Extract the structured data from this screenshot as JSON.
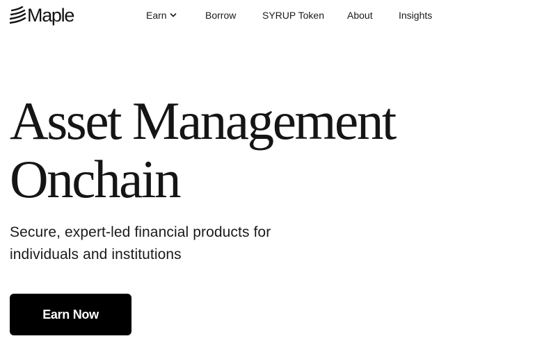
{
  "brand": {
    "name": "Maple",
    "logo_icon": "maple-wave-icon"
  },
  "nav": {
    "items": [
      {
        "label": "Earn",
        "has_dropdown": true,
        "icon": "chevron-down-icon"
      },
      {
        "label": "Borrow"
      },
      {
        "label": "SYRUP Token"
      },
      {
        "label": "About"
      },
      {
        "label": "Insights"
      }
    ]
  },
  "hero": {
    "title_line1": "Asset Management",
    "title_line2": "Onchain",
    "subtitle_line1": "Secure, expert-led financial products for",
    "subtitle_line2": "individuals and institutions",
    "cta_label": "Earn Now"
  },
  "colors": {
    "background": "#ffffff",
    "text": "#111111",
    "button_bg": "#000000",
    "button_text": "#ffffff"
  }
}
